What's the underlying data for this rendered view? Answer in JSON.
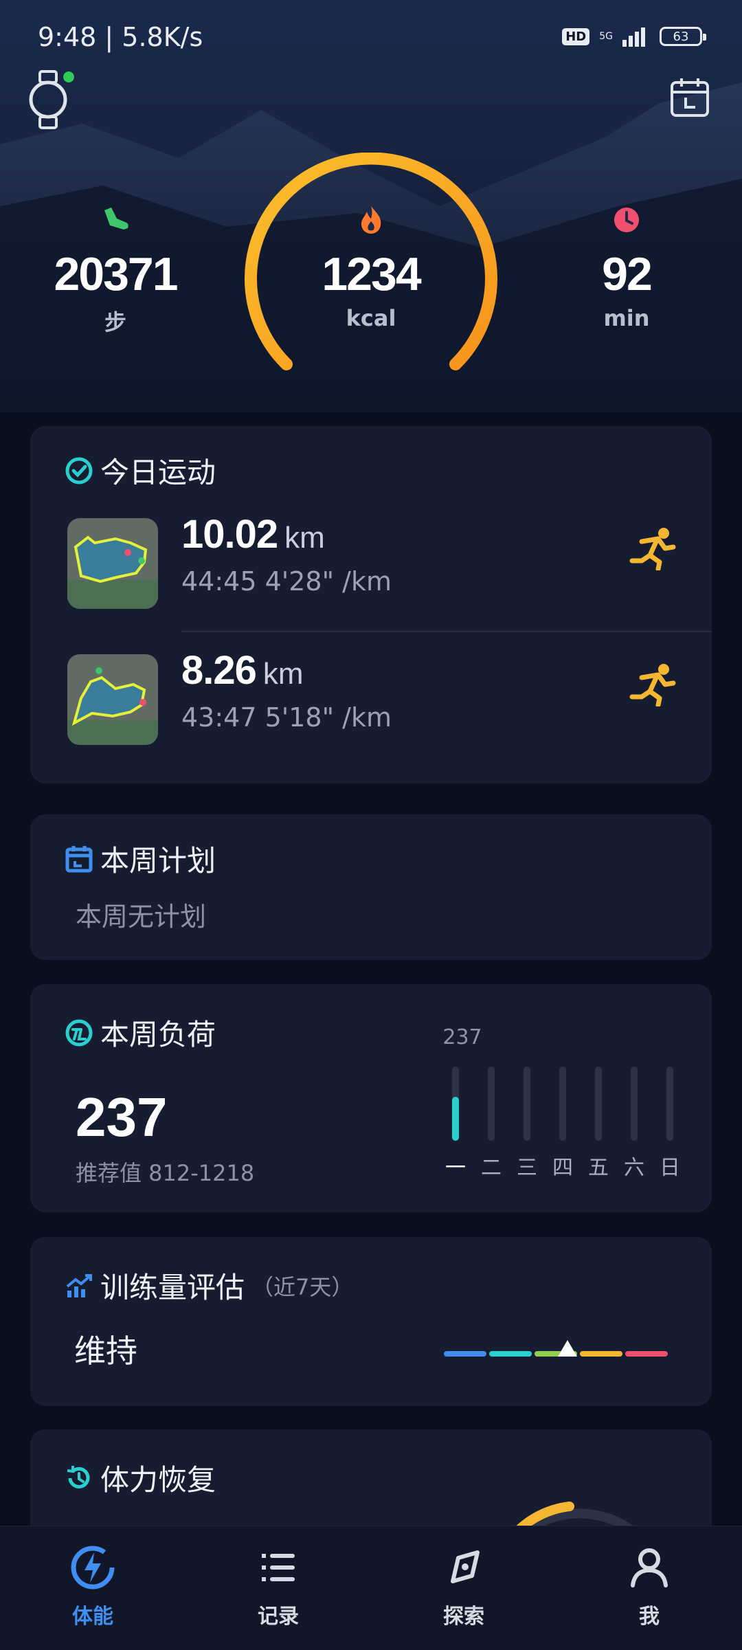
{
  "status_bar": {
    "time": "9:48 | 5.8K/s",
    "hd": "HD",
    "network": "5G",
    "battery": "63"
  },
  "summary": {
    "steps": {
      "value": "20371",
      "unit": "步",
      "icon": "shoe-icon",
      "color": "#3fc56a"
    },
    "calories": {
      "value": "1234",
      "unit": "kcal",
      "icon": "flame-icon",
      "color": "#ff7a2f"
    },
    "duration": {
      "value": "92",
      "unit": "min",
      "icon": "clock-icon",
      "color": "#f0506e"
    }
  },
  "today_exercise": {
    "title": "今日运动",
    "runs": [
      {
        "distance": "10.02",
        "unit": "km",
        "duration": "44:45",
        "pace": "4'28\" /km",
        "icon": "running-icon"
      },
      {
        "distance": "8.26",
        "unit": "km",
        "duration": "43:47",
        "pace": "5'18\" /km",
        "icon": "running-icon"
      }
    ]
  },
  "weekly_plan": {
    "title": "本周计划",
    "empty_text": "本周无计划"
  },
  "weekly_load": {
    "title": "本周负荷",
    "value": "237",
    "recommend": "推荐值 812-1218",
    "peak_label": "237",
    "days": [
      "一",
      "二",
      "三",
      "四",
      "五",
      "六",
      "日"
    ],
    "daily_values": [
      237,
      0,
      0,
      0,
      0,
      0,
      0
    ],
    "bar_max": 400
  },
  "training_eval": {
    "title": "训练量评估",
    "subtitle": "（近7天）",
    "status": "维持",
    "scale_colors": [
      "#3f8ef0",
      "#2ad0d0",
      "#8fd14f",
      "#f5b731",
      "#f0506e"
    ],
    "position": 0.55
  },
  "recovery": {
    "title": "体力恢复"
  },
  "tabs": [
    {
      "label": "体能",
      "icon": "bolt-icon",
      "active": true
    },
    {
      "label": "记录",
      "icon": "list-icon",
      "active": false
    },
    {
      "label": "探索",
      "icon": "compass-icon",
      "active": false
    },
    {
      "label": "我",
      "icon": "user-icon",
      "active": false
    }
  ],
  "colors": {
    "accent": "#3f8ef0",
    "gauge": "#f9a825",
    "teal": "#2ad0d0"
  }
}
